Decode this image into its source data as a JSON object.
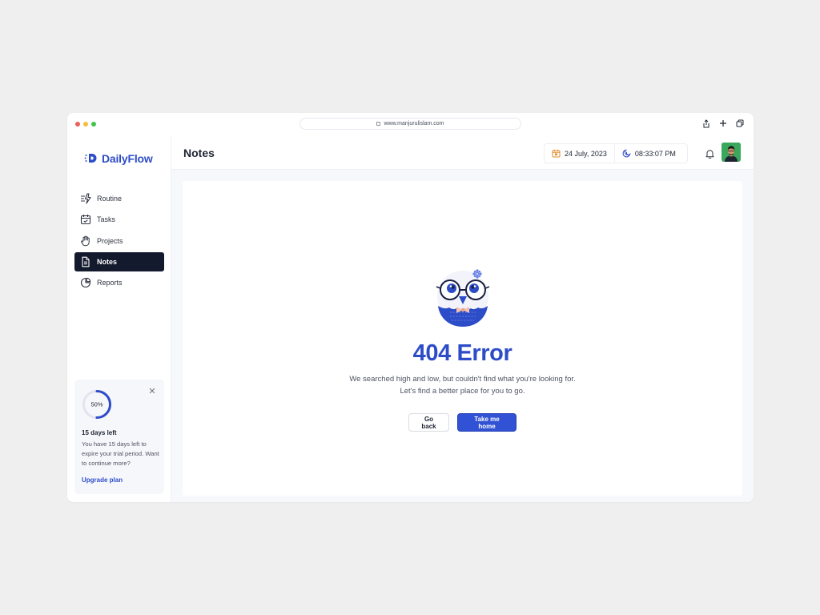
{
  "browser": {
    "url": "www.manjurulislam.com",
    "dot_colors": [
      "#ec5f57",
      "#f5bd3a",
      "#3fc44e"
    ]
  },
  "sidebar": {
    "brand": "DailyFlow",
    "items": [
      {
        "label": "Routine",
        "icon": "bolt-list-icon",
        "active": false
      },
      {
        "label": "Tasks",
        "icon": "calendar-check-icon",
        "active": false
      },
      {
        "label": "Projects",
        "icon": "hand-icon",
        "active": false
      },
      {
        "label": "Notes",
        "icon": "document-icon",
        "active": true
      },
      {
        "label": "Reports",
        "icon": "pie-chart-icon",
        "active": false
      }
    ],
    "trial": {
      "progress_label": "50%",
      "progress": 0.5,
      "title": "15 days left",
      "description": "You have 15 days left to expire your trial period. Want to continue more?",
      "link": "Upgrade plan"
    }
  },
  "header": {
    "title": "Notes",
    "date": "24 July, 2023",
    "time": "08:33:07 PM"
  },
  "main": {
    "error_title": "404 Error",
    "error_line1": "We searched high and low, but couldn't find what you're looking for.",
    "error_line2": "Let's find a better place for you to go.",
    "back_label": "Go back",
    "home_label": "Take me home"
  },
  "colors": {
    "accent": "#2d4cc8",
    "primary_button": "#3152d4",
    "active_nav": "#141a2e"
  }
}
